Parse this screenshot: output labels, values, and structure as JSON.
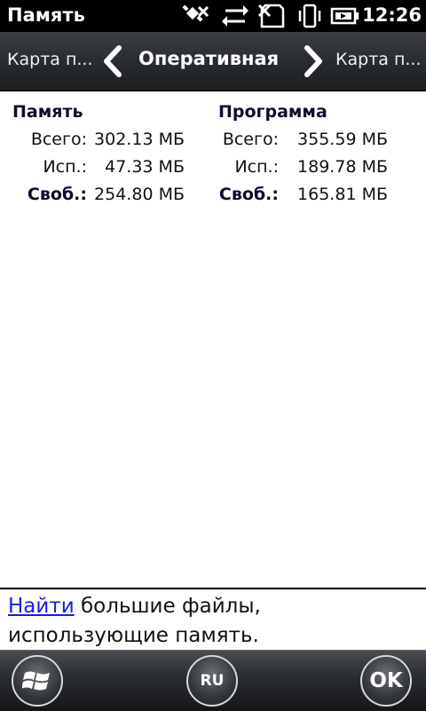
{
  "statusbar": {
    "app_title": "Память",
    "time": "12:26",
    "icons": [
      "no-sim-icon",
      "data-transfer-icon",
      "no-signal-icon",
      "vibrate-icon",
      "battery-charging-icon"
    ]
  },
  "pivot": {
    "left_label": "Карта п...",
    "center_label": "Оперативная",
    "right_label": "Карта п..."
  },
  "memory": {
    "title": "Память",
    "rows": [
      {
        "label": "Всего:",
        "value": "302.13 МБ"
      },
      {
        "label": "Исп.:",
        "value": "47.33 МБ"
      },
      {
        "label": "Своб.:",
        "value": "254.80 МБ"
      }
    ]
  },
  "program": {
    "title": "Программа",
    "rows": [
      {
        "label": "Всего:",
        "value": "355.59 МБ"
      },
      {
        "label": "Исп.:",
        "value": "189.78 МБ"
      },
      {
        "label": "Своб.:",
        "value": "165.81 МБ"
      }
    ]
  },
  "hint": {
    "link_text": "Найти",
    "rest_text": " большие файлы,",
    "line2": "использующие память."
  },
  "softkeys": {
    "lang_label": "RU",
    "ok_label": "OK"
  }
}
